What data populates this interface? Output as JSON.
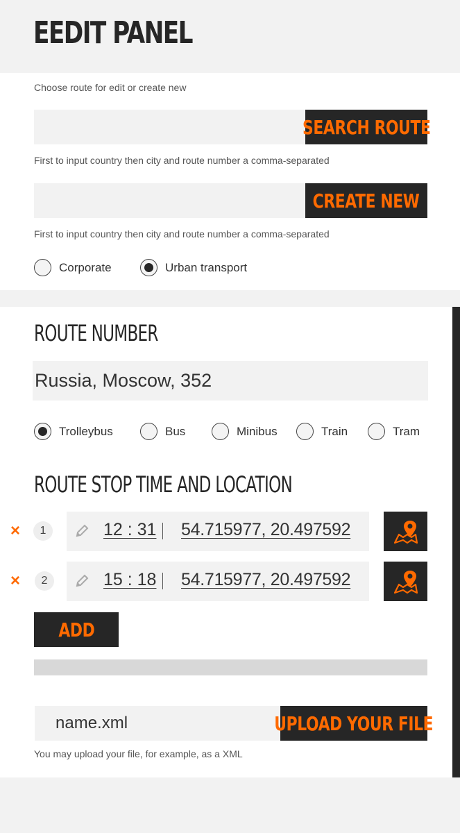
{
  "header": {
    "title": "EEDIT PANEL"
  },
  "choose": {
    "hint": "Choose route for edit  or create new",
    "search_button": "SEARCH ROUTE",
    "search_hint": "First to input country then city and route number a comma-separated",
    "create_button": "CREATE NEW",
    "create_hint": "First to input country then city and route number a comma-separated",
    "category_options": [
      {
        "label": "Corporate",
        "selected": false
      },
      {
        "label": "Urban transport",
        "selected": true
      }
    ]
  },
  "route": {
    "number_title": "ROUTE NUMBER",
    "number_value": "Russia, Moscow, 352",
    "transport_types": [
      {
        "label": "Trolleybus",
        "selected": true
      },
      {
        "label": "Bus",
        "selected": false
      },
      {
        "label": "Minibus",
        "selected": false
      },
      {
        "label": "Train",
        "selected": false
      },
      {
        "label": "Tram",
        "selected": false
      }
    ],
    "stops_title": "ROUTE STOP TIME AND LOCATION",
    "stops": [
      {
        "index": "1",
        "time": "12 : 31",
        "coords": "54.715977, 20.497592"
      },
      {
        "index": "2",
        "time": "15 : 18",
        "coords": "54.715977, 20.497592"
      }
    ],
    "remove_symbol": "×",
    "add_button": "ADD"
  },
  "upload": {
    "file_name": "name.xml",
    "button": "UPLOAD YOUR FILE",
    "hint": "You may upload your file, for example, as a XML"
  },
  "colors": {
    "accent": "#ff6a00",
    "dark": "#262626",
    "field": "#f2f2f2"
  },
  "icons": [
    "pencil-icon",
    "map-pin-icon",
    "close-icon"
  ]
}
